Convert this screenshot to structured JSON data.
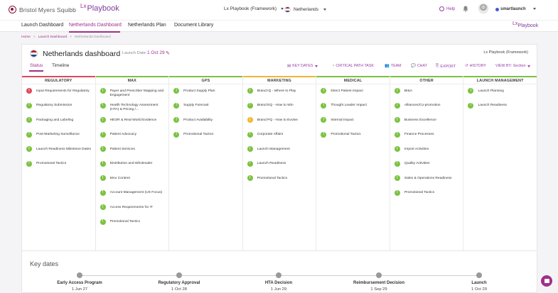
{
  "header": {
    "brand": "Bristol Myers Squibb",
    "lx_logo": "Lx",
    "lx_playbook": "Playbook",
    "framework_select": "Lx Playbook (Framework)",
    "country_select": "Netherlands",
    "help": "Help",
    "account": "smartlaunch",
    "icons": [
      "bell-icon",
      "avatar",
      "help-icon"
    ]
  },
  "nav": {
    "items": [
      "Launch Dashboard",
      "Netherlands Dashboard",
      "Netherlands Plan",
      "Document Library"
    ],
    "active": "Netherlands Dashboard"
  },
  "breadcrumb": [
    "Home",
    "Launch Dashboard",
    "Netherlands Dashboard"
  ],
  "dashboard": {
    "title": "Netherlands dashboard",
    "launch_date_label": "Launch Date:",
    "launch_date": "1 Oct 29",
    "framework": "Lx Playbook (Framework)",
    "tabs": [
      "Status",
      "Timeline"
    ],
    "active_tab": "Status",
    "actions": [
      "KEY DATES",
      "CRITICAL PATH TASK",
      "TEAM",
      "CHAT",
      "EXPORT",
      "HISTORY",
      "VIEW BY: Section"
    ]
  },
  "columns": [
    {
      "title": "REGULATORY",
      "accent": "#e0475b",
      "items": [
        {
          "label": "Input Requirements for Regulatory",
          "status": "red"
        },
        {
          "label": "Regulatory Submission",
          "status": "green"
        },
        {
          "label": "Packaging and Labeling",
          "status": "green"
        },
        {
          "label": "Post-Marketing Surveillance",
          "status": "green"
        },
        {
          "label": "Launch Readiness Milestone Dates",
          "status": "green"
        },
        {
          "label": "Promotional Tactics",
          "status": "green"
        }
      ]
    },
    {
      "title": "MAX",
      "accent": "#7cc242",
      "items": [
        {
          "label": "Payer and Prescriber Mapping and Engagement",
          "status": "green"
        },
        {
          "label": "Health Technology Assessment (HTA) & Pricing /...",
          "status": "green"
        },
        {
          "label": "HEOR & Real World Evidence",
          "status": "green"
        },
        {
          "label": "Patient Advocacy",
          "status": "green"
        },
        {
          "label": "Patient Services",
          "status": "green"
        },
        {
          "label": "Distribution and Wholesaler",
          "status": "green"
        },
        {
          "label": "MAx Content",
          "status": "green"
        },
        {
          "label": "Account Management (US Focus)",
          "status": "green"
        },
        {
          "label": "Access Requirements for IT",
          "status": "green"
        },
        {
          "label": "Promotional Tactics",
          "status": "green"
        }
      ]
    },
    {
      "title": "GPS",
      "accent": "#7cc242",
      "items": [
        {
          "label": "Product Supply Plan",
          "status": "green"
        },
        {
          "label": "Supply Forecast",
          "status": "green"
        },
        {
          "label": "Product Availability",
          "status": "green"
        },
        {
          "label": "Promotional Tactics",
          "status": "green"
        }
      ]
    },
    {
      "title": "MARKETING",
      "accent": "#f2b632",
      "items": [
        {
          "label": "Brand IQ - Where to Play",
          "status": "green"
        },
        {
          "label": "Brand EQ - How to Win",
          "status": "green"
        },
        {
          "label": "Brand PQ - How to Evolve",
          "status": "yellow"
        },
        {
          "label": "Corporate Affairs",
          "status": "green"
        },
        {
          "label": "Launch Management",
          "status": "green"
        },
        {
          "label": "Launch Readiness",
          "status": "green"
        },
        {
          "label": "Promotional Tactics",
          "status": "green"
        }
      ]
    },
    {
      "title": "MEDICAL",
      "accent": "#7cc242",
      "items": [
        {
          "label": "Direct Patient Impact",
          "status": "green"
        },
        {
          "label": "Thought Leader Impact",
          "status": "green"
        },
        {
          "label": "Internal Impact",
          "status": "green"
        },
        {
          "label": "Promotional Tactics",
          "status": "green"
        }
      ]
    },
    {
      "title": "OTHER",
      "accent": "#7cc242",
      "items": [
        {
          "label": "BI&A",
          "status": "green"
        },
        {
          "label": "Alliances/Co-promotion",
          "status": "green"
        },
        {
          "label": "Business Excellence",
          "status": "green"
        },
        {
          "label": "Finance Processes",
          "status": "green"
        },
        {
          "label": "Import Activities",
          "status": "green"
        },
        {
          "label": "Quality Activities",
          "status": "green"
        },
        {
          "label": "Sales & Operations Readiness",
          "status": "green"
        },
        {
          "label": "Promotional Tactics",
          "status": "green"
        }
      ]
    },
    {
      "title": "LAUNCH MANAGEMENT",
      "accent": "#7cc242",
      "items": [
        {
          "label": "Launch Planning",
          "status": "green"
        },
        {
          "label": "Launch Readiness",
          "status": "green"
        }
      ]
    }
  ],
  "key_dates": {
    "title": "Key dates",
    "items": [
      {
        "name": "Early Access Program",
        "date": "1 Jun 27"
      },
      {
        "name": "Regulatory Approval",
        "date": "1 Oct 28"
      },
      {
        "name": "HTA Decision",
        "date": "1 Jun 29"
      },
      {
        "name": "Reimbursement Decision",
        "date": "1 Sep 29"
      },
      {
        "name": "Launch",
        "date": "1 Oct 29"
      }
    ]
  }
}
